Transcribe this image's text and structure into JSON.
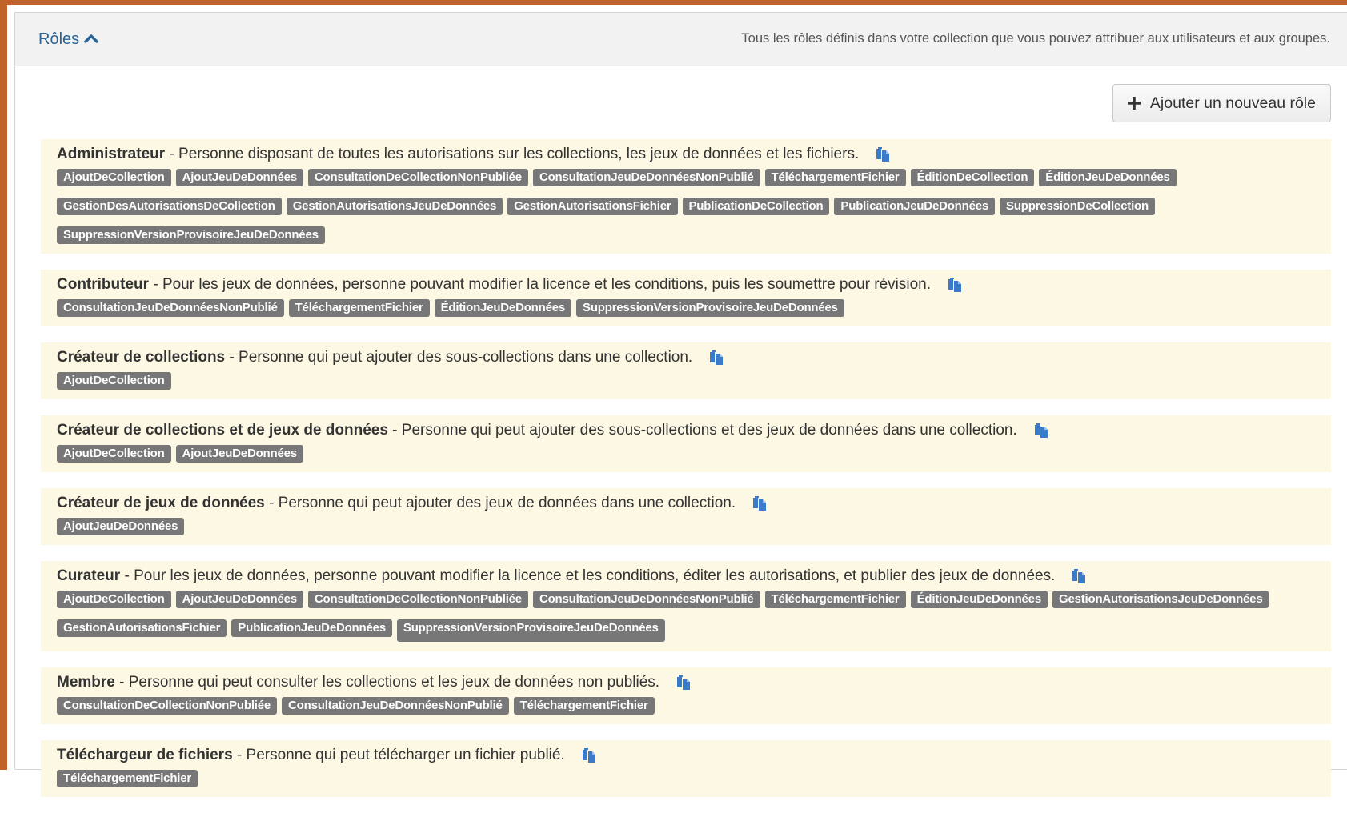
{
  "header": {
    "title": "Rôles",
    "description": "Tous les rôles définis dans votre collection que vous pouvez attribuer aux utilisateurs et aux groupes."
  },
  "add_button": {
    "label": "Ajouter un nouveau rôle"
  },
  "roles": [
    {
      "name": "Administrateur",
      "description": "Personne disposant de toutes les autorisations sur les collections, les jeux de données et les fichiers.",
      "permissions": [
        "AjoutDeCollection",
        "AjoutJeuDeDonnées",
        "ConsultationDeCollectionNonPubliée",
        "ConsultationJeuDeDonnéesNonPublié",
        "TéléchargementFichier",
        "ÉditionDeCollection",
        "ÉditionJeuDeDonnées",
        "GestionDesAutorisationsDeCollection",
        "GestionAutorisationsJeuDeDonnées",
        "GestionAutorisationsFichier",
        "PublicationDeCollection",
        "PublicationJeuDeDonnées",
        "SuppressionDeCollection",
        "SuppressionVersionProvisoireJeuDeDonnées"
      ]
    },
    {
      "name": "Contributeur",
      "description": "Pour les jeux de données, personne pouvant modifier la licence et les conditions, puis les soumettre pour révision.",
      "permissions": [
        "ConsultationJeuDeDonnéesNonPublié",
        "TéléchargementFichier",
        "ÉditionJeuDeDonnées",
        "SuppressionVersionProvisoireJeuDeDonnées"
      ]
    },
    {
      "name": "Créateur de collections",
      "description": "Personne qui peut ajouter des sous-collections dans une collection.",
      "permissions": [
        "AjoutDeCollection"
      ]
    },
    {
      "name": "Créateur de collections et de jeux de données",
      "description": "Personne qui peut ajouter des sous-collections et des jeux de données dans une collection.",
      "permissions": [
        "AjoutDeCollection",
        "AjoutJeuDeDonnées"
      ]
    },
    {
      "name": "Créateur de jeux de données",
      "description": "Personne qui peut ajouter des jeux de données dans une collection.",
      "permissions": [
        "AjoutJeuDeDonnées"
      ]
    },
    {
      "name": "Curateur",
      "description": "Pour les jeux de données, personne pouvant modifier la licence et les conditions, éditer les autorisations, et publier des jeux de données.",
      "permissions": [
        "AjoutDeCollection",
        "AjoutJeuDeDonnées",
        "ConsultationDeCollectionNonPubliée",
        "ConsultationJeuDeDonnéesNonPublié",
        "TéléchargementFichier",
        "ÉditionJeuDeDonnées",
        "GestionAutorisationsJeuDeDonnées",
        "GestionAutorisationsFichier",
        "PublicationJeuDeDonnées",
        "SuppressionVersionProvisoireJeuDeDonnées"
      ]
    },
    {
      "name": "Membre",
      "description": "Personne qui peut consulter les collections et les jeux de données non publiés.",
      "permissions": [
        "ConsultationDeCollectionNonPubliée",
        "ConsultationJeuDeDonnéesNonPublié",
        "TéléchargementFichier"
      ]
    },
    {
      "name": "Téléchargeur de fichiers",
      "description": "Personne qui peut télécharger un fichier publié.",
      "permissions": [
        "TéléchargementFichier"
      ]
    }
  ],
  "separator": " - ",
  "icons": {
    "collapse": "chevron-up-icon",
    "add": "plus-icon",
    "copy": "copy-icon"
  },
  "colors": {
    "frame": "#c0622a",
    "link": "#2a6496",
    "role_bg": "#fcf8e3",
    "tag_bg": "#777777",
    "icon": "#3a7ac8"
  }
}
